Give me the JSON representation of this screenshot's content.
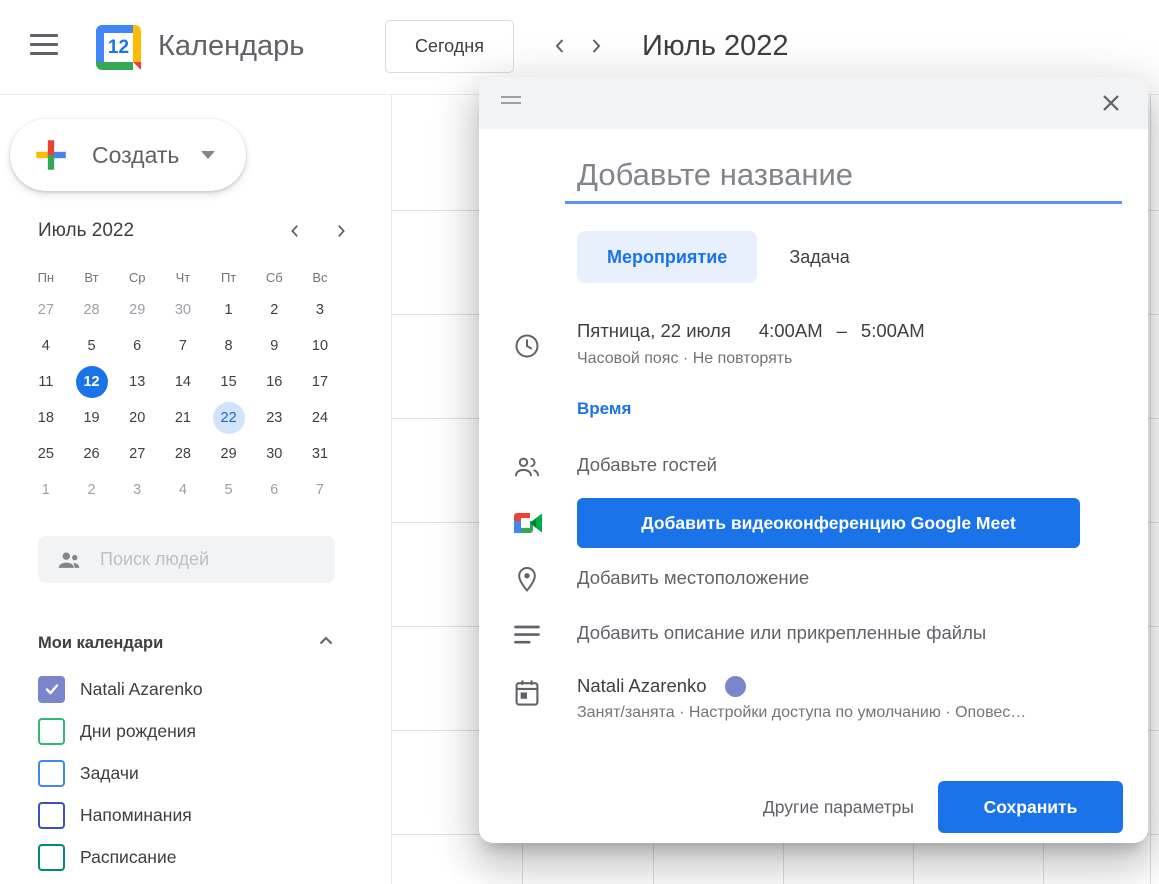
{
  "header": {
    "app_title": "Календарь",
    "logo_day": "12",
    "today_button": "Сегодня",
    "view_title": "Июль 2022"
  },
  "sidebar": {
    "create_button": "Создать",
    "mini_calendar": {
      "month_label": "Июль 2022",
      "day_headers": [
        "Пн",
        "Вт",
        "Ср",
        "Чт",
        "Пт",
        "Сб",
        "Вс"
      ],
      "weeks": [
        [
          {
            "d": "27",
            "s": "m"
          },
          {
            "d": "28",
            "s": "m"
          },
          {
            "d": "29",
            "s": "m"
          },
          {
            "d": "30",
            "s": "m"
          },
          {
            "d": "1"
          },
          {
            "d": "2"
          },
          {
            "d": "3"
          }
        ],
        [
          {
            "d": "4"
          },
          {
            "d": "5"
          },
          {
            "d": "6"
          },
          {
            "d": "7"
          },
          {
            "d": "8"
          },
          {
            "d": "9"
          },
          {
            "d": "10"
          }
        ],
        [
          {
            "d": "11"
          },
          {
            "d": "12",
            "s": "sel"
          },
          {
            "d": "13"
          },
          {
            "d": "14"
          },
          {
            "d": "15"
          },
          {
            "d": "16"
          },
          {
            "d": "17"
          }
        ],
        [
          {
            "d": "18"
          },
          {
            "d": "19"
          },
          {
            "d": "20"
          },
          {
            "d": "21"
          },
          {
            "d": "22",
            "s": "sec"
          },
          {
            "d": "23"
          },
          {
            "d": "24"
          }
        ],
        [
          {
            "d": "25"
          },
          {
            "d": "26"
          },
          {
            "d": "27"
          },
          {
            "d": "28"
          },
          {
            "d": "29"
          },
          {
            "d": "30"
          },
          {
            "d": "31"
          }
        ],
        [
          {
            "d": "1",
            "s": "m"
          },
          {
            "d": "2",
            "s": "m"
          },
          {
            "d": "3",
            "s": "m"
          },
          {
            "d": "4",
            "s": "m"
          },
          {
            "d": "5",
            "s": "m"
          },
          {
            "d": "6",
            "s": "m"
          },
          {
            "d": "7",
            "s": "m"
          }
        ]
      ],
      "selected_day": "12",
      "secondary_day": "22"
    },
    "search_placeholder": "Поиск людей",
    "my_calendars": {
      "title": "Мои календари",
      "items": [
        {
          "label": "Natali Azarenko",
          "color": "#7986cb",
          "checked": true
        },
        {
          "label": "Дни рождения",
          "color": "#33b679",
          "checked": false
        },
        {
          "label": "Задачи",
          "color": "#4285f4",
          "checked": false
        },
        {
          "label": "Напоминания",
          "color": "#3f51b5",
          "checked": false
        },
        {
          "label": "Расписание",
          "color": "#00897b",
          "checked": false
        }
      ]
    }
  },
  "dialog": {
    "title_placeholder": "Добавьте название",
    "tabs": [
      {
        "label": "Мероприятие",
        "selected": true
      },
      {
        "label": "Задача",
        "selected": false
      }
    ],
    "time": {
      "date": "Пятница, 22 июля",
      "start": "4:00AM",
      "separator": "–",
      "end": "5:00AM",
      "details": "Часовой пояс · Не повторять",
      "link": "Время"
    },
    "guests_placeholder": "Добавьте гостей",
    "meet_button": "Добавить видеоконференцию Google Meet",
    "location_placeholder": "Добавить местоположение",
    "description_placeholder": "Добавить описание или прикрепленные файлы",
    "calendar_row": {
      "owner": "Natali Azarenko",
      "dot_color": "#7986cb",
      "details": "Занят/занята · Настройки доступа по умолчанию · Оповес…"
    },
    "footer": {
      "more_options": "Другие параметры",
      "save": "Сохранить"
    }
  },
  "colors": {
    "accent": "#1a73e8",
    "tab_chip_bg": "#e8f0fe",
    "selected_day_bg": "#1a73e8",
    "secondary_day_bg": "#d2e3fc",
    "dialog_header_bg": "#f1f3f4"
  }
}
